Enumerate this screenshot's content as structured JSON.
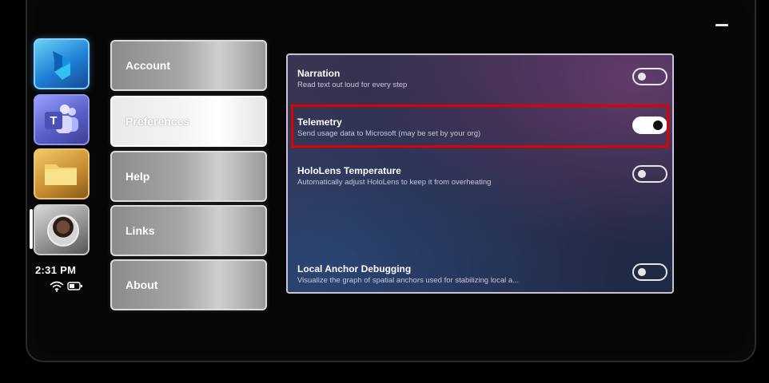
{
  "window": {
    "minimize_label": "—"
  },
  "rail": {
    "apps": [
      {
        "name": "Dynamics 365 Guides",
        "icon": "dynamics-guides-icon"
      },
      {
        "name": "Microsoft Teams",
        "icon": "teams-icon"
      },
      {
        "name": "Files",
        "icon": "folder-icon"
      },
      {
        "name": "Profile",
        "icon": "avatar-icon"
      }
    ],
    "teams_letter": "T",
    "time": "2:31 PM",
    "status_icons": [
      "wifi-icon",
      "battery-icon"
    ]
  },
  "nav": {
    "items": [
      {
        "label": "Account",
        "selected": false
      },
      {
        "label": "Preferences",
        "selected": true
      },
      {
        "label": "Help",
        "selected": false
      },
      {
        "label": "Links",
        "selected": false
      },
      {
        "label": "About",
        "selected": false
      }
    ]
  },
  "settings": {
    "items": [
      {
        "title": "Narration",
        "description": "Read text out loud for every step",
        "enabled": false
      },
      {
        "title": "Telemetry",
        "description": "Send usage data to Microsoft (may be set by your org)",
        "enabled": true,
        "highlighted": true
      },
      {
        "title": "HoloLens Temperature",
        "description": "Automatically adjust HoloLens to keep it from overheating",
        "enabled": false
      },
      {
        "title": "Local Anchor Debugging",
        "description": "Visualize the graph of spatial anchors used for stabilizing local a...",
        "enabled": false
      }
    ]
  },
  "colors": {
    "highlight": "#e00000",
    "panel_border": "#c9c2d8"
  }
}
